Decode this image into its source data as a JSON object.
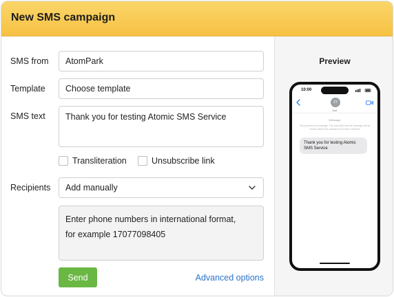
{
  "header": {
    "title": "New SMS campaign"
  },
  "form": {
    "sms_from": {
      "label": "SMS from",
      "value": "AtomPark"
    },
    "template": {
      "label": "Template",
      "value": "Choose template"
    },
    "sms_text": {
      "label": "SMS text",
      "value": "Thank you for testing Atomic SMS Service"
    },
    "transliteration": {
      "label": "Transliteration",
      "checked": false
    },
    "unsubscribe": {
      "label": "Unsubscribe link",
      "checked": false
    },
    "recipients": {
      "label": "Recipients",
      "selected": "Add manually",
      "placeholder_line1": "Enter phone numbers in international format,",
      "placeholder_line2": "for example 17077098405"
    },
    "send_label": "Send",
    "advanced_label": "Advanced options"
  },
  "preview": {
    "title": "Preview",
    "phone": {
      "time": "10:00",
      "avatar_initials": "ZT",
      "contact_name": "Zoe",
      "thread_header": "iMessage",
      "thread_note": "This preview is a message. The real SMS and the message will be shown where the software won't been selected",
      "bubble_text": "Thank you for testing Atomic SMS Service"
    }
  },
  "colors": {
    "header": "#f6c143",
    "send_button": "#6ab744",
    "link": "#2a73c9"
  },
  "icons": {
    "dropdown": "chevron-down-icon",
    "back": "chevron-left-icon",
    "video": "video-camera-icon"
  }
}
